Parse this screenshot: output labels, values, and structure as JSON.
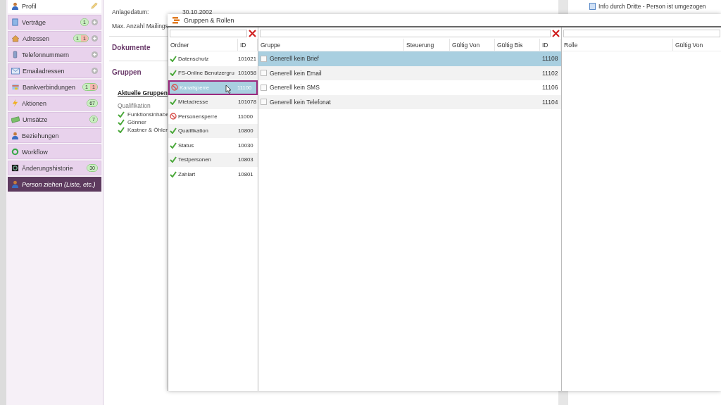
{
  "sidebar": {
    "items": [
      {
        "label": "Profil",
        "kind": "nav",
        "selected": true,
        "edit": true
      },
      {
        "label": "Verträge",
        "kind": "nav",
        "selected": false,
        "badges": [
          {
            "text": "1",
            "color": "#c8efbf"
          }
        ],
        "add": true
      },
      {
        "label": "Adressen",
        "kind": "nav",
        "selected": false,
        "badges": [
          {
            "text": "1",
            "color": "#c8efbf"
          },
          {
            "text": "1",
            "color": "#f5b8ae"
          }
        ],
        "add": true
      },
      {
        "label": "Telefonnummern",
        "kind": "nav",
        "selected": false,
        "add": true
      },
      {
        "label": "Emailadressen",
        "kind": "nav",
        "selected": false,
        "add": true
      },
      {
        "label": "Bankverbindungen",
        "kind": "nav",
        "selected": false,
        "badges": [
          {
            "text": "1",
            "color": "#c8efbf"
          },
          {
            "text": "1",
            "color": "#f5b8ae"
          }
        ]
      },
      {
        "label": "Aktionen",
        "kind": "nav",
        "selected": false,
        "badges": [
          {
            "text": "67",
            "color": "#c8efbf"
          }
        ]
      },
      {
        "label": "Umsätze",
        "kind": "nav",
        "selected": false,
        "badges": [
          {
            "text": "7",
            "color": "#c8efbf"
          }
        ]
      },
      {
        "label": "Beziehungen",
        "kind": "nav",
        "selected": false
      },
      {
        "label": "Workflow",
        "kind": "nav",
        "selected": false
      },
      {
        "label": "Änderungshistorie",
        "kind": "nav",
        "selected": false,
        "badges": [
          {
            "text": "30",
            "color": "#c8efbf"
          }
        ]
      },
      {
        "label": "Person ziehen (Liste, etc.)",
        "kind": "action",
        "selected": false
      }
    ]
  },
  "profile": {
    "fields": [
      {
        "label": "Anlagedatum:",
        "value": "30.10.2002"
      },
      {
        "label": "Max. Anzahl Mailings"
      }
    ],
    "sections": [
      "Dokumente",
      "Gruppen"
    ],
    "current_groups": {
      "title": "Aktuelle Gruppen",
      "category": "Qualifikation",
      "items": [
        "Funktionsinhabe",
        "Gönner",
        "Kastner & Öhler"
      ]
    }
  },
  "notes": [
    {
      "text": "Info durch Dritte - Person ist umgezogen"
    }
  ],
  "dialog": {
    "title": "Gruppen & Rollen",
    "folders": {
      "columns": [
        "Ordner",
        "ID"
      ],
      "rows": [
        {
          "name": "Datenschutz",
          "id": "101021",
          "kind": "ok",
          "selected": false
        },
        {
          "name": "FS-Online Benutzergru",
          "id": "101058",
          "kind": "ok",
          "selected": false
        },
        {
          "name": "Kanalsperre",
          "id": "11100",
          "kind": "blocked",
          "selected": true
        },
        {
          "name": "Mietadresse",
          "id": "101078",
          "kind": "ok",
          "selected": false
        },
        {
          "name": "Personensperre",
          "id": "11000",
          "kind": "blocked",
          "selected": false
        },
        {
          "name": "Qualifikation",
          "id": "10800",
          "kind": "ok",
          "selected": false
        },
        {
          "name": "Status",
          "id": "10030",
          "kind": "ok",
          "selected": false
        },
        {
          "name": "Testpersonen",
          "id": "10803",
          "kind": "ok",
          "selected": false
        },
        {
          "name": "Zahlart",
          "id": "10801",
          "kind": "ok",
          "selected": false
        }
      ]
    },
    "groups": {
      "columns": [
        "Gruppe",
        "Steuerung",
        "Gültig Von",
        "Gültig Bis",
        "ID"
      ],
      "rows": [
        {
          "name": "Generell kein Brief",
          "id": "11108",
          "checked": false,
          "selected": true
        },
        {
          "name": "Generell kein Email",
          "id": "11102",
          "checked": false,
          "selected": false
        },
        {
          "name": "Generell kein SMS",
          "id": "11106",
          "checked": false,
          "selected": false
        },
        {
          "name": "Generell kein Telefonat",
          "id": "11104",
          "checked": false,
          "selected": false
        }
      ]
    },
    "roles": {
      "columns": [
        "Rolle",
        "Gültig Von"
      ]
    }
  }
}
